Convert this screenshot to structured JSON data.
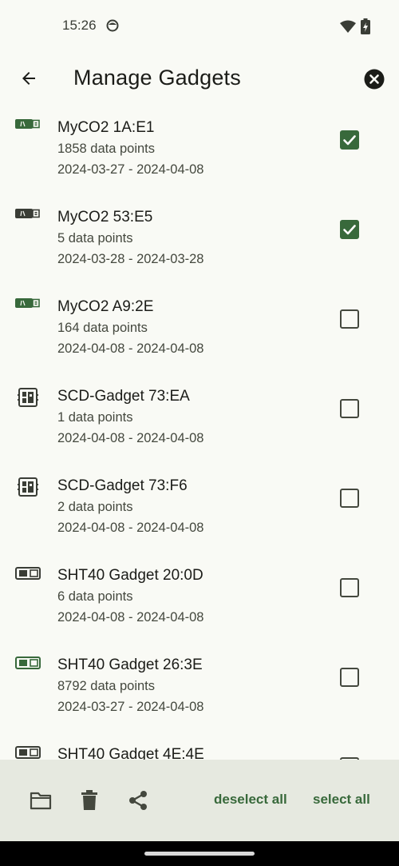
{
  "status_bar": {
    "time": "15:26"
  },
  "app_bar": {
    "title": "Manage Gadgets"
  },
  "gadgets": [
    {
      "name": "MyCO2 1A:E1",
      "points": "1858 data points",
      "range": "2024-03-27 - 2024-04-08",
      "icon": "myco2-usb-icon",
      "icon_color": "#38693b",
      "checked": true
    },
    {
      "name": "MyCO2 53:E5",
      "points": "5 data points",
      "range": "2024-03-28 - 2024-03-28",
      "icon": "myco2-usb-icon",
      "icon_color": "#3a3d36",
      "checked": true
    },
    {
      "name": "MyCO2 A9:2E",
      "points": "164 data points",
      "range": "2024-04-08 - 2024-04-08",
      "icon": "myco2-usb-icon",
      "icon_color": "#38693b",
      "checked": false
    },
    {
      "name": "SCD-Gadget 73:EA",
      "points": "1 data points",
      "range": "2024-04-08 - 2024-04-08",
      "icon": "scd-gadget-icon",
      "icon_color": "#3a3d36",
      "checked": false
    },
    {
      "name": "SCD-Gadget 73:F6",
      "points": "2 data points",
      "range": "2024-04-08 - 2024-04-08",
      "icon": "scd-gadget-icon",
      "icon_color": "#3a3d36",
      "checked": false
    },
    {
      "name": "SHT40 Gadget 20:0D",
      "points": "6 data points",
      "range": "2024-04-08 - 2024-04-08",
      "icon": "sht40-gadget-icon",
      "icon_color": "#3a3d36",
      "checked": false
    },
    {
      "name": "SHT40 Gadget 26:3E",
      "points": "8792 data points",
      "range": "2024-03-27 - 2024-04-08",
      "icon": "sht40-gadget-icon",
      "icon_color": "#38693b",
      "checked": false
    },
    {
      "name": "SHT40 Gadget 4E:4E",
      "points": "",
      "range": "",
      "icon": "sht40-gadget-icon",
      "icon_color": "#3a3d36",
      "checked": false
    }
  ],
  "bottom_bar": {
    "deselect_label": "deselect all",
    "select_label": "select all",
    "accent": "#38693b"
  }
}
